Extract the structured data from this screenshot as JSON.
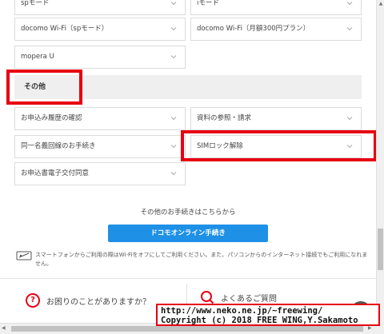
{
  "grid": {
    "top_row": [
      {
        "label": "spモード"
      },
      {
        "label": "iモード"
      }
    ],
    "row2": [
      {
        "label": "docomo Wi-Fi（spモード）"
      },
      {
        "label": "docomo Wi-Fi（月額300円プラン）"
      }
    ],
    "row3": [
      {
        "label": "mopera U"
      }
    ]
  },
  "section": {
    "title": "その他"
  },
  "other_items": [
    {
      "label": "お申込み履歴の確認"
    },
    {
      "label": "資料の参照・請求"
    },
    {
      "label": "同一名義回線のお手続き"
    },
    {
      "label": "SIMロック解除"
    },
    {
      "label": "お申込書電子交付同意"
    }
  ],
  "procedures": {
    "intro": "その他のお手続きはこちらから",
    "button_label": "ドコモオンライン手続き",
    "smartphone_note": "スマートフォンからご利用の際はWi-Fiをオフにしてご利用ください。また、パソコンからのインターネット接続でもご利用になれません。"
  },
  "help": {
    "question": "お困りのことがありますか？",
    "faq": "よくあるご質問"
  },
  "watermark": {
    "line1": "http://www.neko.ne.jp/~freewing/",
    "line2": "Copyright (c) 2018 FREE WING,Y.Sakamoto"
  },
  "colors": {
    "accent_red": "#e60012",
    "button_blue": "#1e90e6",
    "section_bg": "#efefef"
  }
}
